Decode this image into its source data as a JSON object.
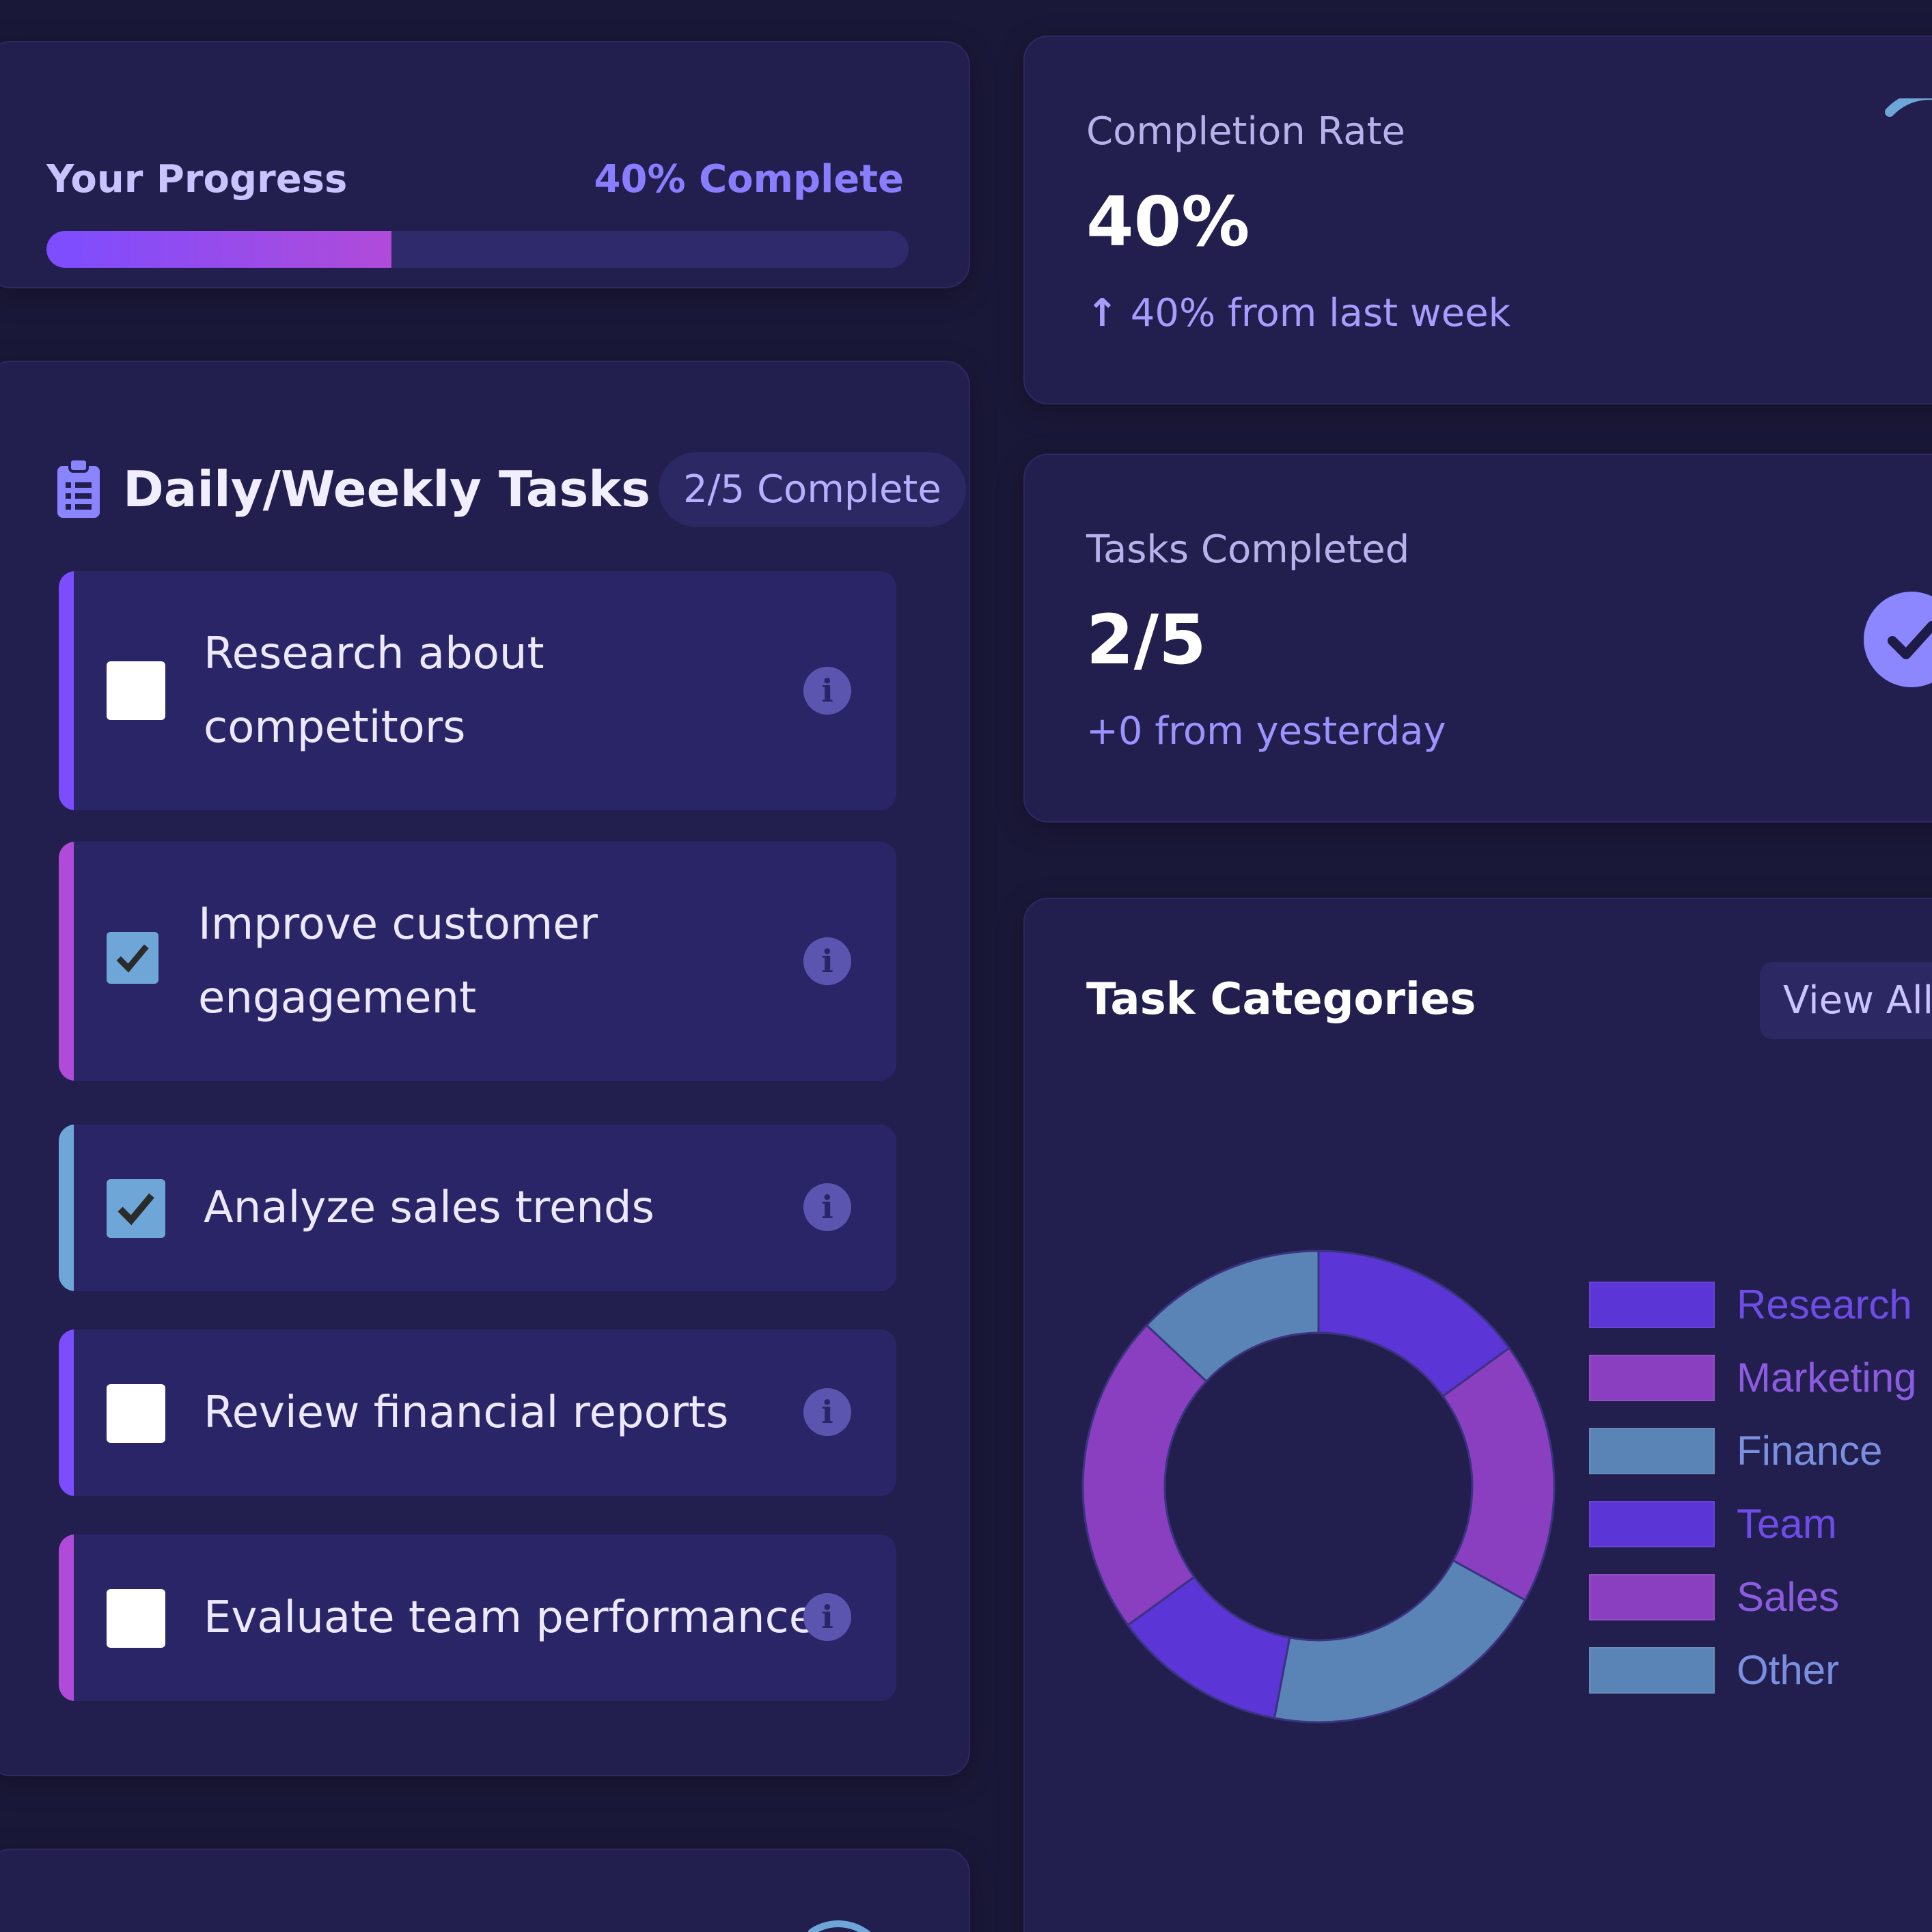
{
  "progress": {
    "title": "Your Progress",
    "percent_label": "40% Complete",
    "percent": 40
  },
  "tasks": {
    "title": "Daily/Weekly Tasks",
    "badge": "2/5 Complete",
    "items": [
      {
        "label": "Research about competitors",
        "checked": false,
        "accent": "#7c4dff"
      },
      {
        "label": "Improve customer engagement",
        "checked": true,
        "accent": "#b04bd9"
      },
      {
        "label": "Analyze sales trends",
        "checked": true,
        "accent": "#6fa6d8"
      },
      {
        "label": "Review financial reports",
        "checked": false,
        "accent": "#7c4dff"
      },
      {
        "label": "Evaluate team performance",
        "checked": false,
        "accent": "#b04bd9"
      }
    ]
  },
  "completion": {
    "label": "Completion Rate",
    "value": "40%",
    "change": "40% from last week"
  },
  "tasks_completed": {
    "label": "Tasks Completed",
    "value": "2/5",
    "change": "+0 from yesterday"
  },
  "categories": {
    "title": "Task Categories",
    "view_all": "View All"
  },
  "chart_data": {
    "type": "pie",
    "categories": [
      "Research",
      "Marketing",
      "Finance",
      "Team",
      "Sales",
      "Other"
    ],
    "values": [
      15,
      18,
      20,
      12,
      22,
      13
    ],
    "colors": [
      "#5b35d5",
      "#8a3fc0",
      "#5a84b5",
      "#5b35d5",
      "#8a3fc0",
      "#5a84b5"
    ],
    "legend_position": "right"
  },
  "colors": {
    "accent_purple": "#7c4dff",
    "accent_magenta": "#b04bd9",
    "accent_blue": "#6fa6d8",
    "background": "#1a1838",
    "card": "#221f4f"
  }
}
